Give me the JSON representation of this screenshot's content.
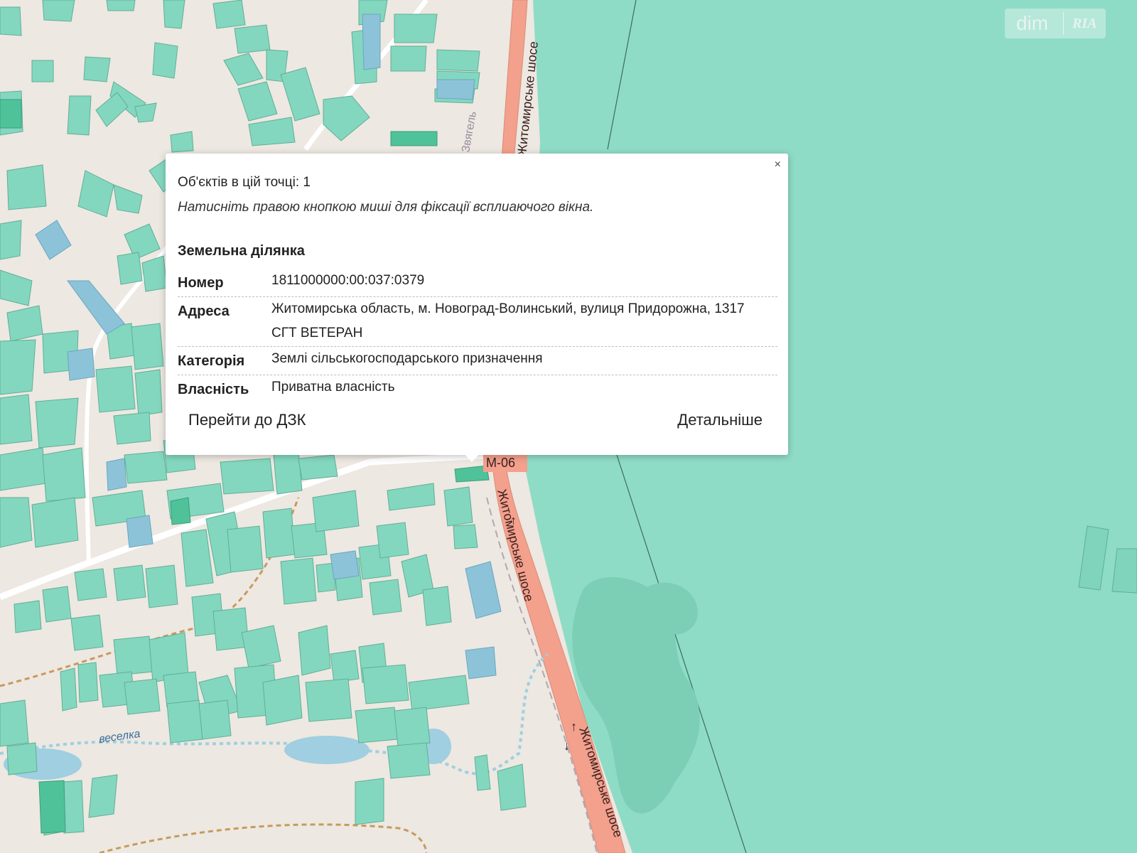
{
  "map": {
    "road_labels": [
      "Житомирське шосе",
      "Житомирське шосе",
      "Житомирське шосе"
    ],
    "route_badge": "М-06",
    "stream_label": "веселка",
    "street_label": "Звягель",
    "colors": {
      "background": "#ede8e1",
      "parcel": "#84d7bf",
      "parcel_stroke": "#5fae97",
      "parcel_dark": "#4fc29a",
      "parcel_blue": "#8cc3d9",
      "large_field": "#8fdcc6",
      "road": "#f3a08c",
      "water": "#9fcfe0"
    }
  },
  "watermark": {
    "brand": "dim",
    "brand2": "RIA"
  },
  "popup": {
    "close_symbol": "×",
    "objects_count": "Об'єктів в цій точці: 1",
    "hint": "Натисніть правою кнопкою миші для фіксації всплиаючого вікна.",
    "section_title": "Земельна ділянка",
    "rows": [
      {
        "key": "Номер",
        "value": "1811000000:00:037:0379"
      },
      {
        "key": "Адреса",
        "value": "Житомирська область, м. Новоград-Волинський, вулиця Придорожна, 1317 СГТ ВЕТЕРАН"
      },
      {
        "key": "Категорія",
        "value": "Землі сільськогосподарського призначення"
      },
      {
        "key": "Власність",
        "value": "Приватна власність"
      }
    ],
    "btn_dzk": "Перейти до ДЗК",
    "btn_more": "Детальніше"
  }
}
